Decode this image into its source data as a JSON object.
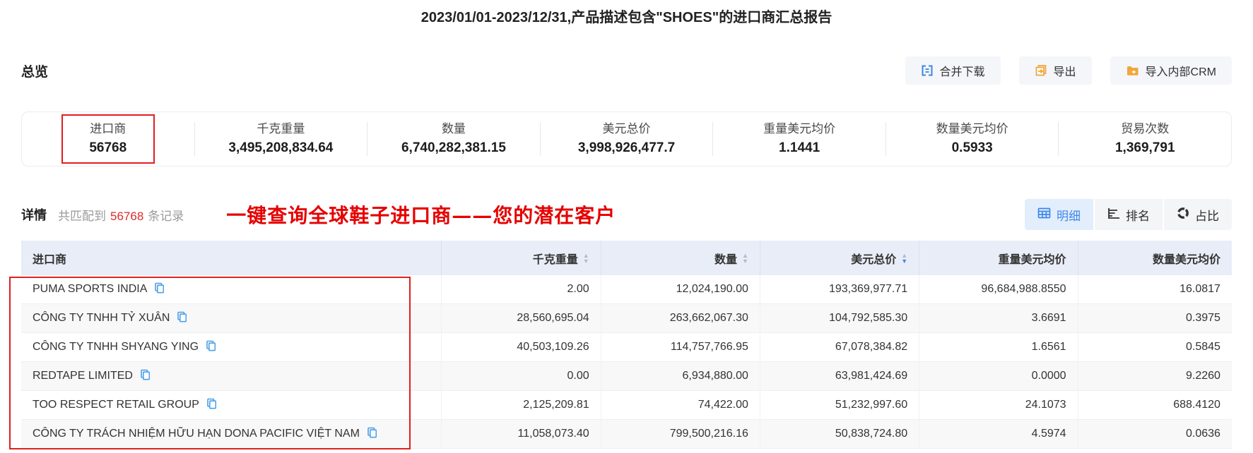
{
  "title": "2023/01/01-2023/12/31,产品描述包含\"SHOES\"的进口商汇总报告",
  "overview": {
    "heading": "总览",
    "actions": [
      {
        "label": "合并下载",
        "icon": "merge-download-icon"
      },
      {
        "label": "导出",
        "icon": "export-icon"
      },
      {
        "label": "导入内部CRM",
        "icon": "import-crm-icon"
      }
    ],
    "stats": [
      {
        "label": "进口商",
        "value": "56768",
        "highlighted": true
      },
      {
        "label": "千克重量",
        "value": "3,495,208,834.64"
      },
      {
        "label": "数量",
        "value": "6,740,282,381.15"
      },
      {
        "label": "美元总价",
        "value": "3,998,926,477.7"
      },
      {
        "label": "重量美元均价",
        "value": "1.1441"
      },
      {
        "label": "数量美元均价",
        "value": "0.5933"
      },
      {
        "label": "贸易次数",
        "value": "1,369,791"
      }
    ]
  },
  "detail": {
    "heading": "详情",
    "match_prefix": "共匹配到",
    "match_count": "56768",
    "match_suffix": "条记录",
    "annotation": "一键查询全球鞋子进口商——您的潜在客户",
    "tabs": [
      {
        "label": "明细",
        "icon": "table-icon",
        "active": true
      },
      {
        "label": "排名",
        "icon": "ranking-bars-icon",
        "active": false
      },
      {
        "label": "占比",
        "icon": "donut-chart-icon",
        "active": false
      }
    ]
  },
  "table": {
    "columns": [
      {
        "label": "进口商",
        "sortable": false
      },
      {
        "label": "千克重量",
        "sortable": true,
        "sort": "none"
      },
      {
        "label": "数量",
        "sortable": true,
        "sort": "none"
      },
      {
        "label": "美元总价",
        "sortable": true,
        "sort": "desc"
      },
      {
        "label": "重量美元均价",
        "sortable": false
      },
      {
        "label": "数量美元均价",
        "sortable": false
      }
    ],
    "rows": [
      {
        "importer": "PUMA SPORTS INDIA",
        "weight_kg": "2.00",
        "quantity": "12,024,190.00",
        "usd_total": "193,369,977.71",
        "usd_per_weight": "96,684,988.8550",
        "usd_per_qty": "16.0817"
      },
      {
        "importer": "CÔNG TY TNHH TỶ XUÂN",
        "weight_kg": "28,560,695.04",
        "quantity": "263,662,067.30",
        "usd_total": "104,792,585.30",
        "usd_per_weight": "3.6691",
        "usd_per_qty": "0.3975"
      },
      {
        "importer": "CÔNG TY TNHH SHYANG YING",
        "weight_kg": "40,503,109.26",
        "quantity": "114,757,766.95",
        "usd_total": "67,078,384.82",
        "usd_per_weight": "1.6561",
        "usd_per_qty": "0.5845"
      },
      {
        "importer": "REDTAPE LIMITED",
        "weight_kg": "0.00",
        "quantity": "6,934,880.00",
        "usd_total": "63,981,424.69",
        "usd_per_weight": "0.0000",
        "usd_per_qty": "9.2260"
      },
      {
        "importer": "TOO RESPECT RETAIL GROUP",
        "weight_kg": "2,125,209.81",
        "quantity": "74,422.00",
        "usd_total": "51,232,997.60",
        "usd_per_weight": "24.1073",
        "usd_per_qty": "688.4120"
      },
      {
        "importer": "CÔNG TY TRÁCH NHIỆM HỮU HẠN DONA PACIFIC VIỆT NAM",
        "weight_kg": "11,058,073.40",
        "quantity": "799,500,216.16",
        "usd_total": "50,838,724.80",
        "usd_per_weight": "4.5974",
        "usd_per_qty": "0.0636"
      }
    ]
  },
  "accents": {
    "primary_blue": "#3c87e8",
    "icon_orange": "#f0a63c",
    "annotation_red": "#e60000",
    "count_red": "#e02b2b",
    "header_bg": "#e9edf7"
  }
}
